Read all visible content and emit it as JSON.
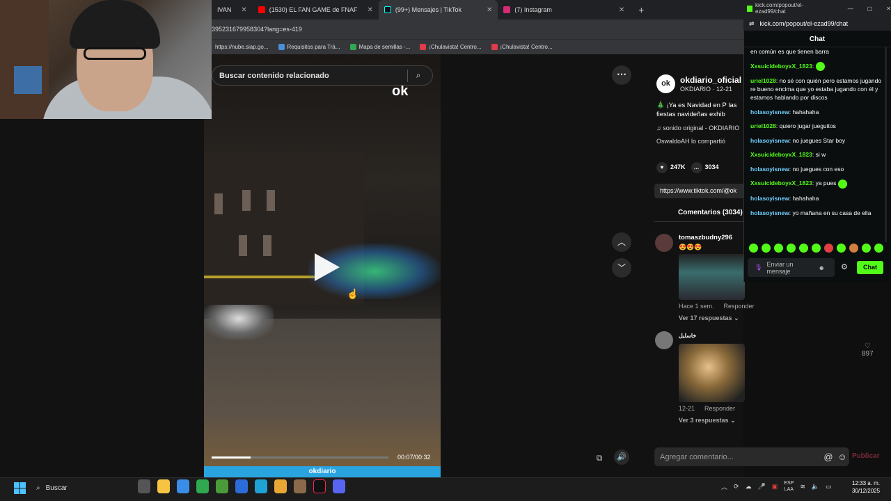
{
  "browser": {
    "tabs": [
      {
        "label": "IVAN",
        "color": "#888888"
      },
      {
        "label": "(1530) EL FAN GAME de FNAF",
        "color": "#ff0000"
      },
      {
        "label": "(99+) Mensajes | TikTok",
        "color": "#111111",
        "active": true
      },
      {
        "label": "(7) Instagram",
        "color": "#d62976"
      }
    ],
    "new_tab_symbol": "+",
    "url": "395231679958304?lang=es-419",
    "bookmarks": [
      {
        "label": "https://nube.siap.go...",
        "color": "#555555"
      },
      {
        "label": "Requisitos para Trá...",
        "color": "#4a8fd9"
      },
      {
        "label": "Mapa de semillas -...",
        "color": "#2fa84f"
      },
      {
        "label": "¡Chulavista! Centro...",
        "color": "#e03b4b"
      },
      {
        "label": "¡Chulavista! Centro...",
        "color": "#e03b4b"
      }
    ]
  },
  "video": {
    "search_placeholder": "Buscar contenido relacionado",
    "logo": "ok",
    "footer_brand": "okdiario",
    "progress": 0.22,
    "time": "00:07/00:32"
  },
  "post": {
    "avatar_text": "ok",
    "author": "okdiario_oficial",
    "author_sub": "OKDIARIO · 12-21",
    "description": "🎄 ¡Ya es Navidad en P las fiestas navideñas exhib",
    "music": "♫  sonido original - OKDIARIO",
    "shared": "OswaldoAH lo compartió",
    "likes": "247K",
    "comments_count": "3034",
    "link": "https://www.tiktok.com/@ok",
    "comments_tab": "Comentarios (3034)"
  },
  "comments": [
    {
      "name": "tomaszbudny296",
      "text": "😍😍😍",
      "meta_time": "Hace 1 sem.",
      "reply": "Responder",
      "replies": "Ver 17 respuestas"
    },
    {
      "name": "خاسلبل",
      "text": "",
      "meta_time": "12-21",
      "reply": "Responder",
      "replies": "Ver 3 respuestas",
      "likes": "897"
    }
  ],
  "comment_input": {
    "placeholder": "Agregar comentario...",
    "publish": "Publicar"
  },
  "kick": {
    "window_title": "kick.com/popout/el-ezad99/chat",
    "url": "kick.com/popout/el-ezad99/chat",
    "header": "Chat",
    "messages": [
      {
        "user": "",
        "text": "en común es que tienen barra"
      },
      {
        "user": "XxsuicideboyxX_1823",
        "text": "",
        "emote": true
      },
      {
        "user": "uriel1028",
        "text": "no sé con quién pero estamos jugando re bueno encima que yo estaba jugando con él y estamos hablando por discos"
      },
      {
        "user": "holasoyisnew",
        "text": "hahahaha"
      },
      {
        "user": "uriel1028",
        "text": "quiero jugar jueguitos"
      },
      {
        "user": "holasoyisnew",
        "text": "no juegues Star boy"
      },
      {
        "user": "XxsuicideboyxX_1823",
        "text": "si w"
      },
      {
        "user": "holasoyisnew",
        "text": "no juegues con eso"
      },
      {
        "user": "XxsuicideboyxX_1823",
        "text": "ya pues",
        "emote": true
      },
      {
        "user": "holasoyisnew",
        "text": "hahahaha"
      },
      {
        "user": "holasoyisnew",
        "text": "yo mañana en su casa de ella"
      }
    ],
    "input_placeholder": "Enviar un mensaje",
    "chat_button": "Chat",
    "accent": "#53fc18"
  },
  "taskbar": {
    "search": "Buscar",
    "lang": "ESP",
    "lang2": "LAA",
    "time": "12:33 a. m.",
    "date": "30/12/2025"
  }
}
